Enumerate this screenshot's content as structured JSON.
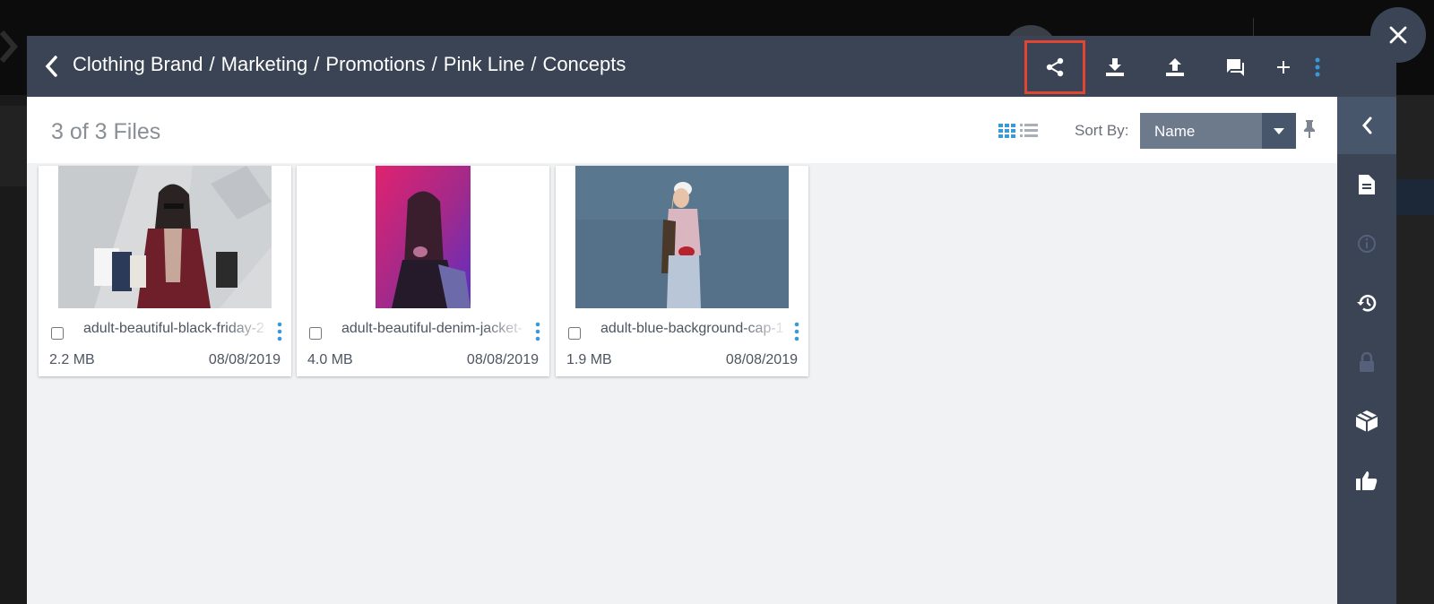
{
  "header": {
    "breadcrumb": [
      "Clothing Brand",
      "Marketing",
      "Promotions",
      "Pink Line",
      "Concepts"
    ],
    "separator": "/",
    "actions": [
      "share",
      "download",
      "upload",
      "comments",
      "add",
      "more"
    ]
  },
  "toolbar": {
    "file_count": "3 of 3 Files",
    "sort_label": "Sort By:",
    "sort_value": "Name"
  },
  "files": [
    {
      "name": "adult-beautiful-black-friday-2",
      "size": "2.2 MB",
      "date": "08/08/2019"
    },
    {
      "name": "adult-beautiful-denim-jacket-",
      "size": "4.0 MB",
      "date": "08/08/2019"
    },
    {
      "name": "adult-blue-background-cap-1",
      "size": "1.9 MB",
      "date": "08/08/2019"
    }
  ],
  "sidebar": {
    "items": [
      "document",
      "info",
      "history",
      "lock",
      "boxes",
      "thumbs-up"
    ]
  },
  "colors": {
    "header_bg": "#3a4454",
    "highlight": "#e24633",
    "accent": "#3a9ad9"
  }
}
